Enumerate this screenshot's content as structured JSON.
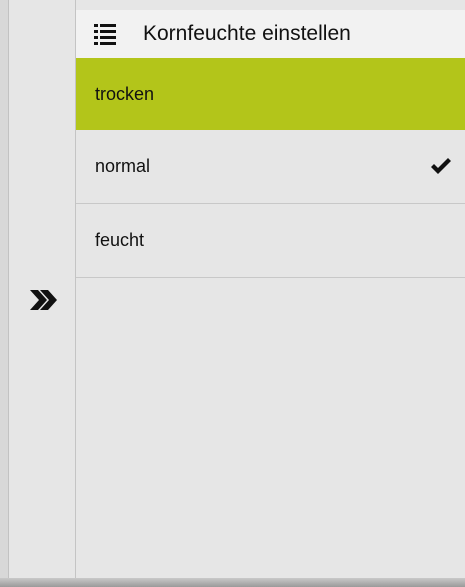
{
  "header": {
    "title": "Kornfeuchte einstellen",
    "menu_icon": "list-icon"
  },
  "sidebar": {
    "expand_icon": "double-chevron-right-icon"
  },
  "options": [
    {
      "label": "trocken",
      "highlighted": true,
      "checked": false
    },
    {
      "label": "normal",
      "highlighted": false,
      "checked": true
    },
    {
      "label": "feucht",
      "highlighted": false,
      "checked": false
    }
  ],
  "colors": {
    "highlight": "#b3c51a",
    "background": "#e6e6e6",
    "header_bg": "#f2f2f2"
  }
}
